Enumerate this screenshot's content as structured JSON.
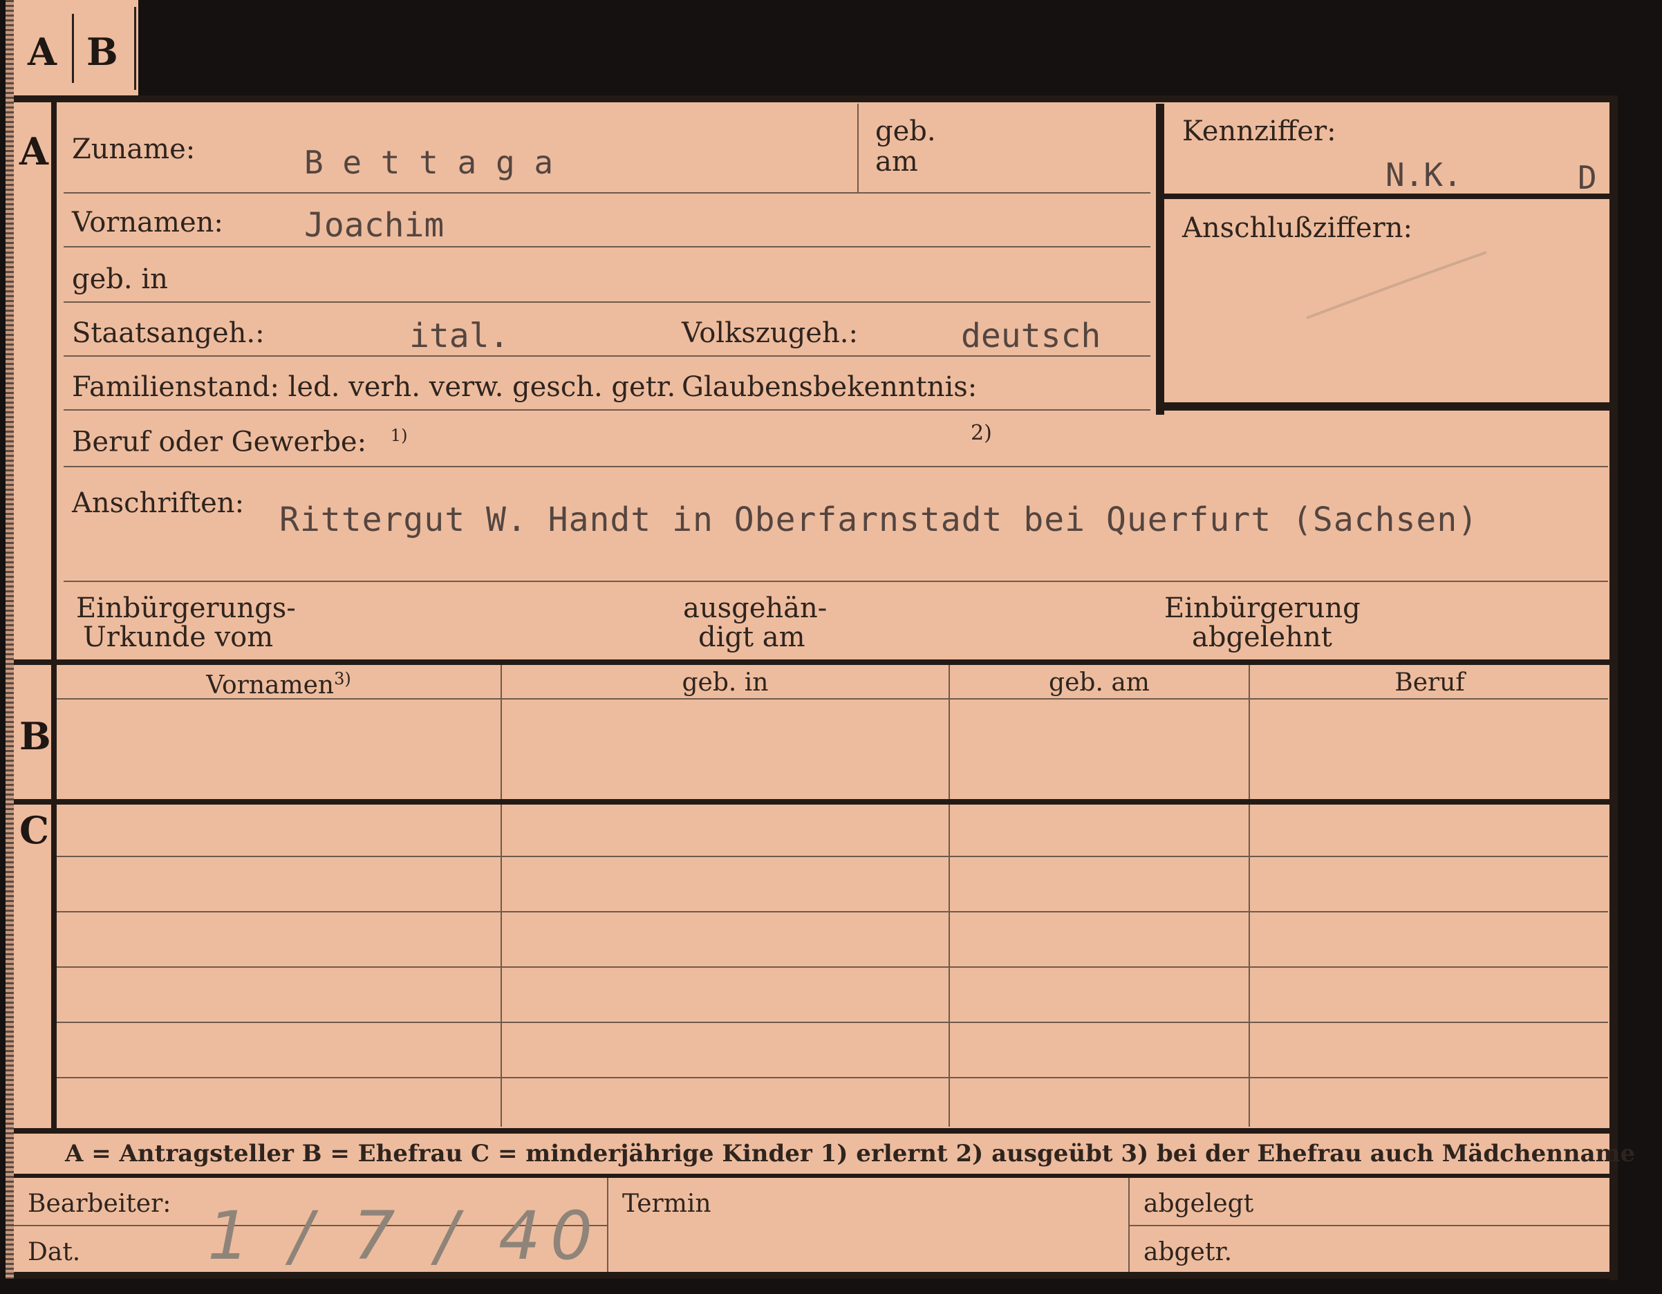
{
  "tab": {
    "a": "A",
    "b": "B"
  },
  "sections": {
    "a": "A",
    "b": "B",
    "c": "C"
  },
  "top": {
    "zuname_label": "Zuname:",
    "zuname_value": "B e t t a g a",
    "geb_am_label_1": "geb.",
    "geb_am_label_2": "am",
    "vornamen_label": "Vornamen:",
    "vornamen_value": "Joachim",
    "geb_in_label": "geb. in",
    "staatsangeh_label": "Staatsangeh.:",
    "staatsangeh_value": "ital.",
    "volkszugeh_label": "Volkszugeh.:",
    "volkszugeh_value": "deutsch",
    "familienstand_label": "Familienstand: led. verh. verw. gesch. getr.",
    "glaubensbekenntnis_label": "Glaubensbekenntnis:",
    "beruf_label": "Beruf oder Gewerbe:",
    "beruf_sup1": "1)",
    "beruf_sup2": "2)",
    "anschriften_label": "Anschriften:",
    "anschriften_value": "Rittergut W. Handt in Oberfarnstadt bei Querfurt (Sachsen)",
    "einb_urkunde_1": "Einbürgerungs-",
    "einb_urkunde_2": "Urkunde vom",
    "ausgehaendigt_1": "ausgehän-",
    "ausgehaendigt_2": "digt am",
    "einb_abgelehnt_1": "Einbürgerung",
    "einb_abgelehnt_2": "abgelehnt"
  },
  "right_box": {
    "kennziffer_label": "Kennziffer:",
    "kennziffer_value": "N.K.",
    "kennziffer_letter": "D",
    "anschlussziffern_label": "Anschlußziffern:"
  },
  "table": {
    "headers": [
      "Vornamen",
      "geb. in",
      "geb. am",
      "Beruf"
    ],
    "header_sup": "3)"
  },
  "legend": {
    "text": "A = Antragsteller   B = Ehefrau   C = minderjährige Kinder   1) erlernt   2) ausgeübt   3) bei der Ehefrau auch Mädchenname"
  },
  "footer": {
    "bearbeiter_label": "Bearbeiter:",
    "dat_label": "Dat.",
    "dat_value": "1 / 7 / 40",
    "termin_label": "Termin",
    "abgelegt_label": "abgelegt",
    "abgetr_label": "abgetr."
  },
  "colors": {
    "card": "#edbc9e",
    "ink": "#2f241e",
    "typewriter": "#544540",
    "pencil": "#8f8479",
    "border": "#231a16",
    "background": "#141110"
  }
}
